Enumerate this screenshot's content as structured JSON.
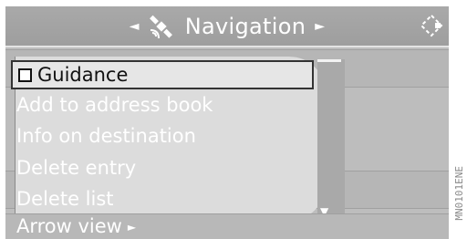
{
  "header": {
    "title": "Navigation",
    "icon": "satellite-icon",
    "corner_icon": "diamond-nav-icon"
  },
  "menu": {
    "items": [
      {
        "label": "Guidance",
        "selected": true,
        "checkbox": true
      },
      {
        "label": "Add to address book",
        "selected": false
      },
      {
        "label": "Info on destination",
        "selected": false
      },
      {
        "label": "Delete entry",
        "selected": false
      },
      {
        "label": "Delete list",
        "selected": false
      }
    ]
  },
  "footer": {
    "label": "Arrow view"
  },
  "figure_code": "MN0101ENE"
}
